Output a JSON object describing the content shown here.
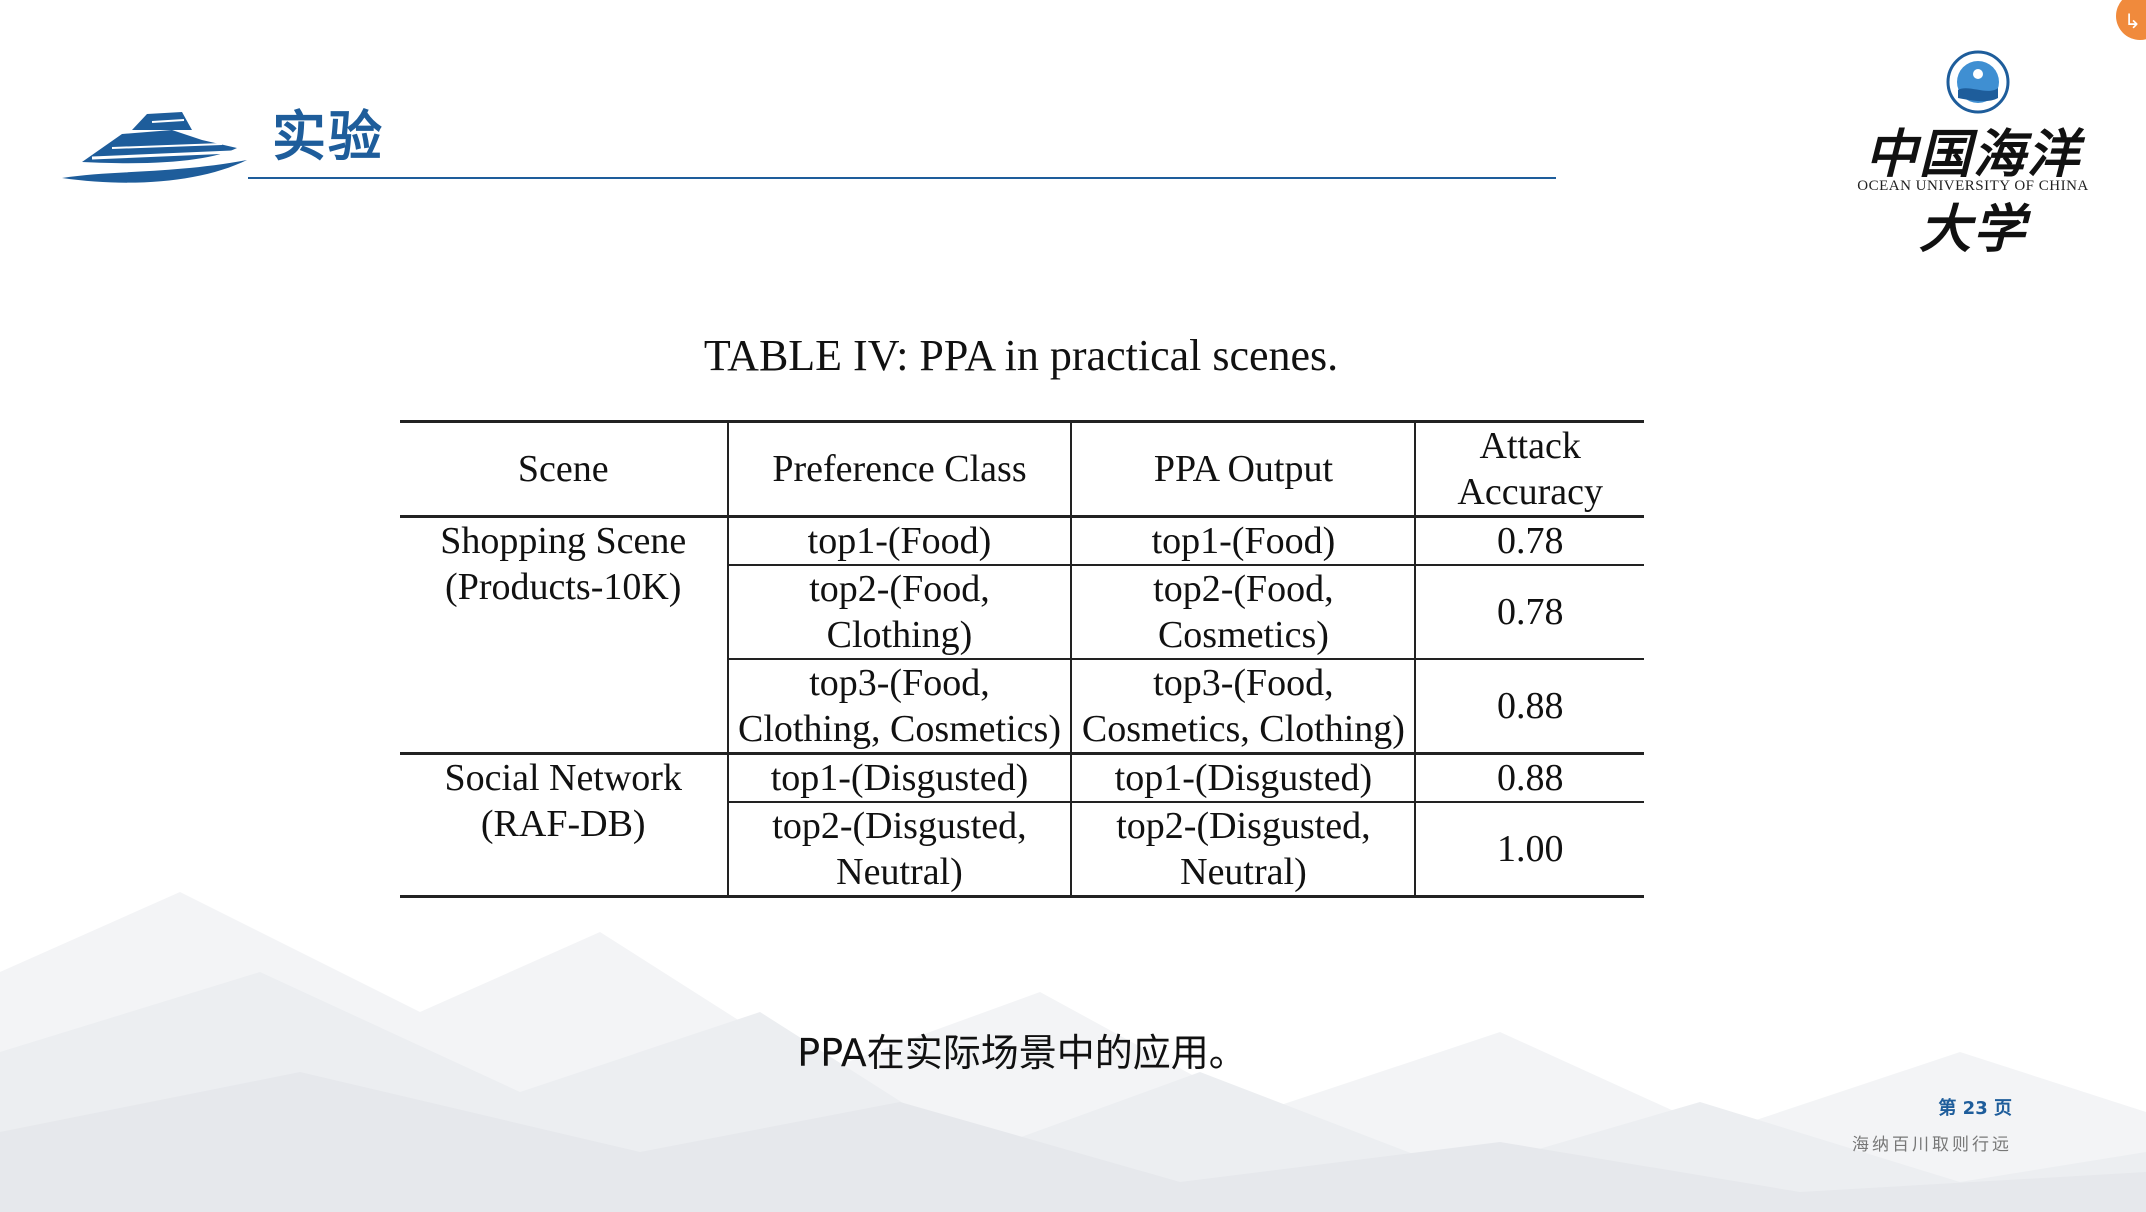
{
  "header": {
    "section_title": "实验"
  },
  "university": {
    "name_cn": "中国海洋大学",
    "name_en": "OCEAN UNIVERSITY OF CHINA"
  },
  "table": {
    "caption": "TABLE IV: PPA in practical scenes.",
    "columns": [
      "Scene",
      "Preference Class",
      "PPA Output",
      "Attack Accuracy"
    ],
    "groups": [
      {
        "scene": "Shopping Scene (Products-10K)",
        "rows": [
          {
            "preference": "top1-(Food)",
            "output": "top1-(Food)",
            "accuracy": "0.78"
          },
          {
            "preference": "top2-(Food, Clothing)",
            "output": "top2-(Food, Cosmetics)",
            "accuracy": "0.78"
          },
          {
            "preference": "top3-(Food, Clothing, Cosmetics)",
            "output": "top3-(Food, Cosmetics, Clothing)",
            "accuracy": "0.88"
          }
        ]
      },
      {
        "scene": "Social Network (RAF-DB)",
        "rows": [
          {
            "preference": "top1-(Disgusted)",
            "output": "top1-(Disgusted)",
            "accuracy": "0.88"
          },
          {
            "preference": "top2-(Disgusted, Neutral)",
            "output": "top2-(Disgusted, Neutral)",
            "accuracy": "1.00"
          }
        ]
      }
    ]
  },
  "slide_caption": "PPA在实际场景中的应用。",
  "footer": {
    "page_number": "第 23 页",
    "motto": "海纳百川取则行远"
  },
  "colors": {
    "accent": "#1e5d9b",
    "corner_badge": "#f08a3c"
  }
}
